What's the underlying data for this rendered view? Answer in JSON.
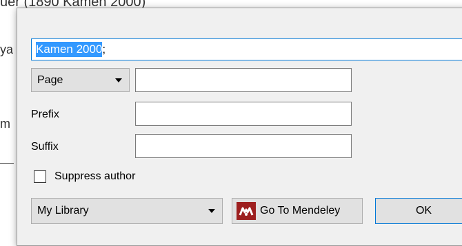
{
  "background": {
    "top_text": "uer (1890 Kamen 2000)",
    "frag_1": "ya",
    "frag_2": "m"
  },
  "dialog": {
    "citation_value": "Kamen 2000",
    "citation_suffix": ";",
    "locator_select": {
      "selected": "Page"
    },
    "prefix_label": "Prefix",
    "suffix_label": "Suffix",
    "suppress_author_label": "Suppress author",
    "library_select": {
      "selected": "My Library"
    },
    "go_to_mendeley_label": "Go To Mendeley",
    "ok_label": "OK",
    "colors": {
      "accent": "#0078d7",
      "mendeley_logo": "#9d1f1f"
    },
    "icons": [
      "mendeley-logo-icon",
      "chevron-down-icon"
    ]
  }
}
